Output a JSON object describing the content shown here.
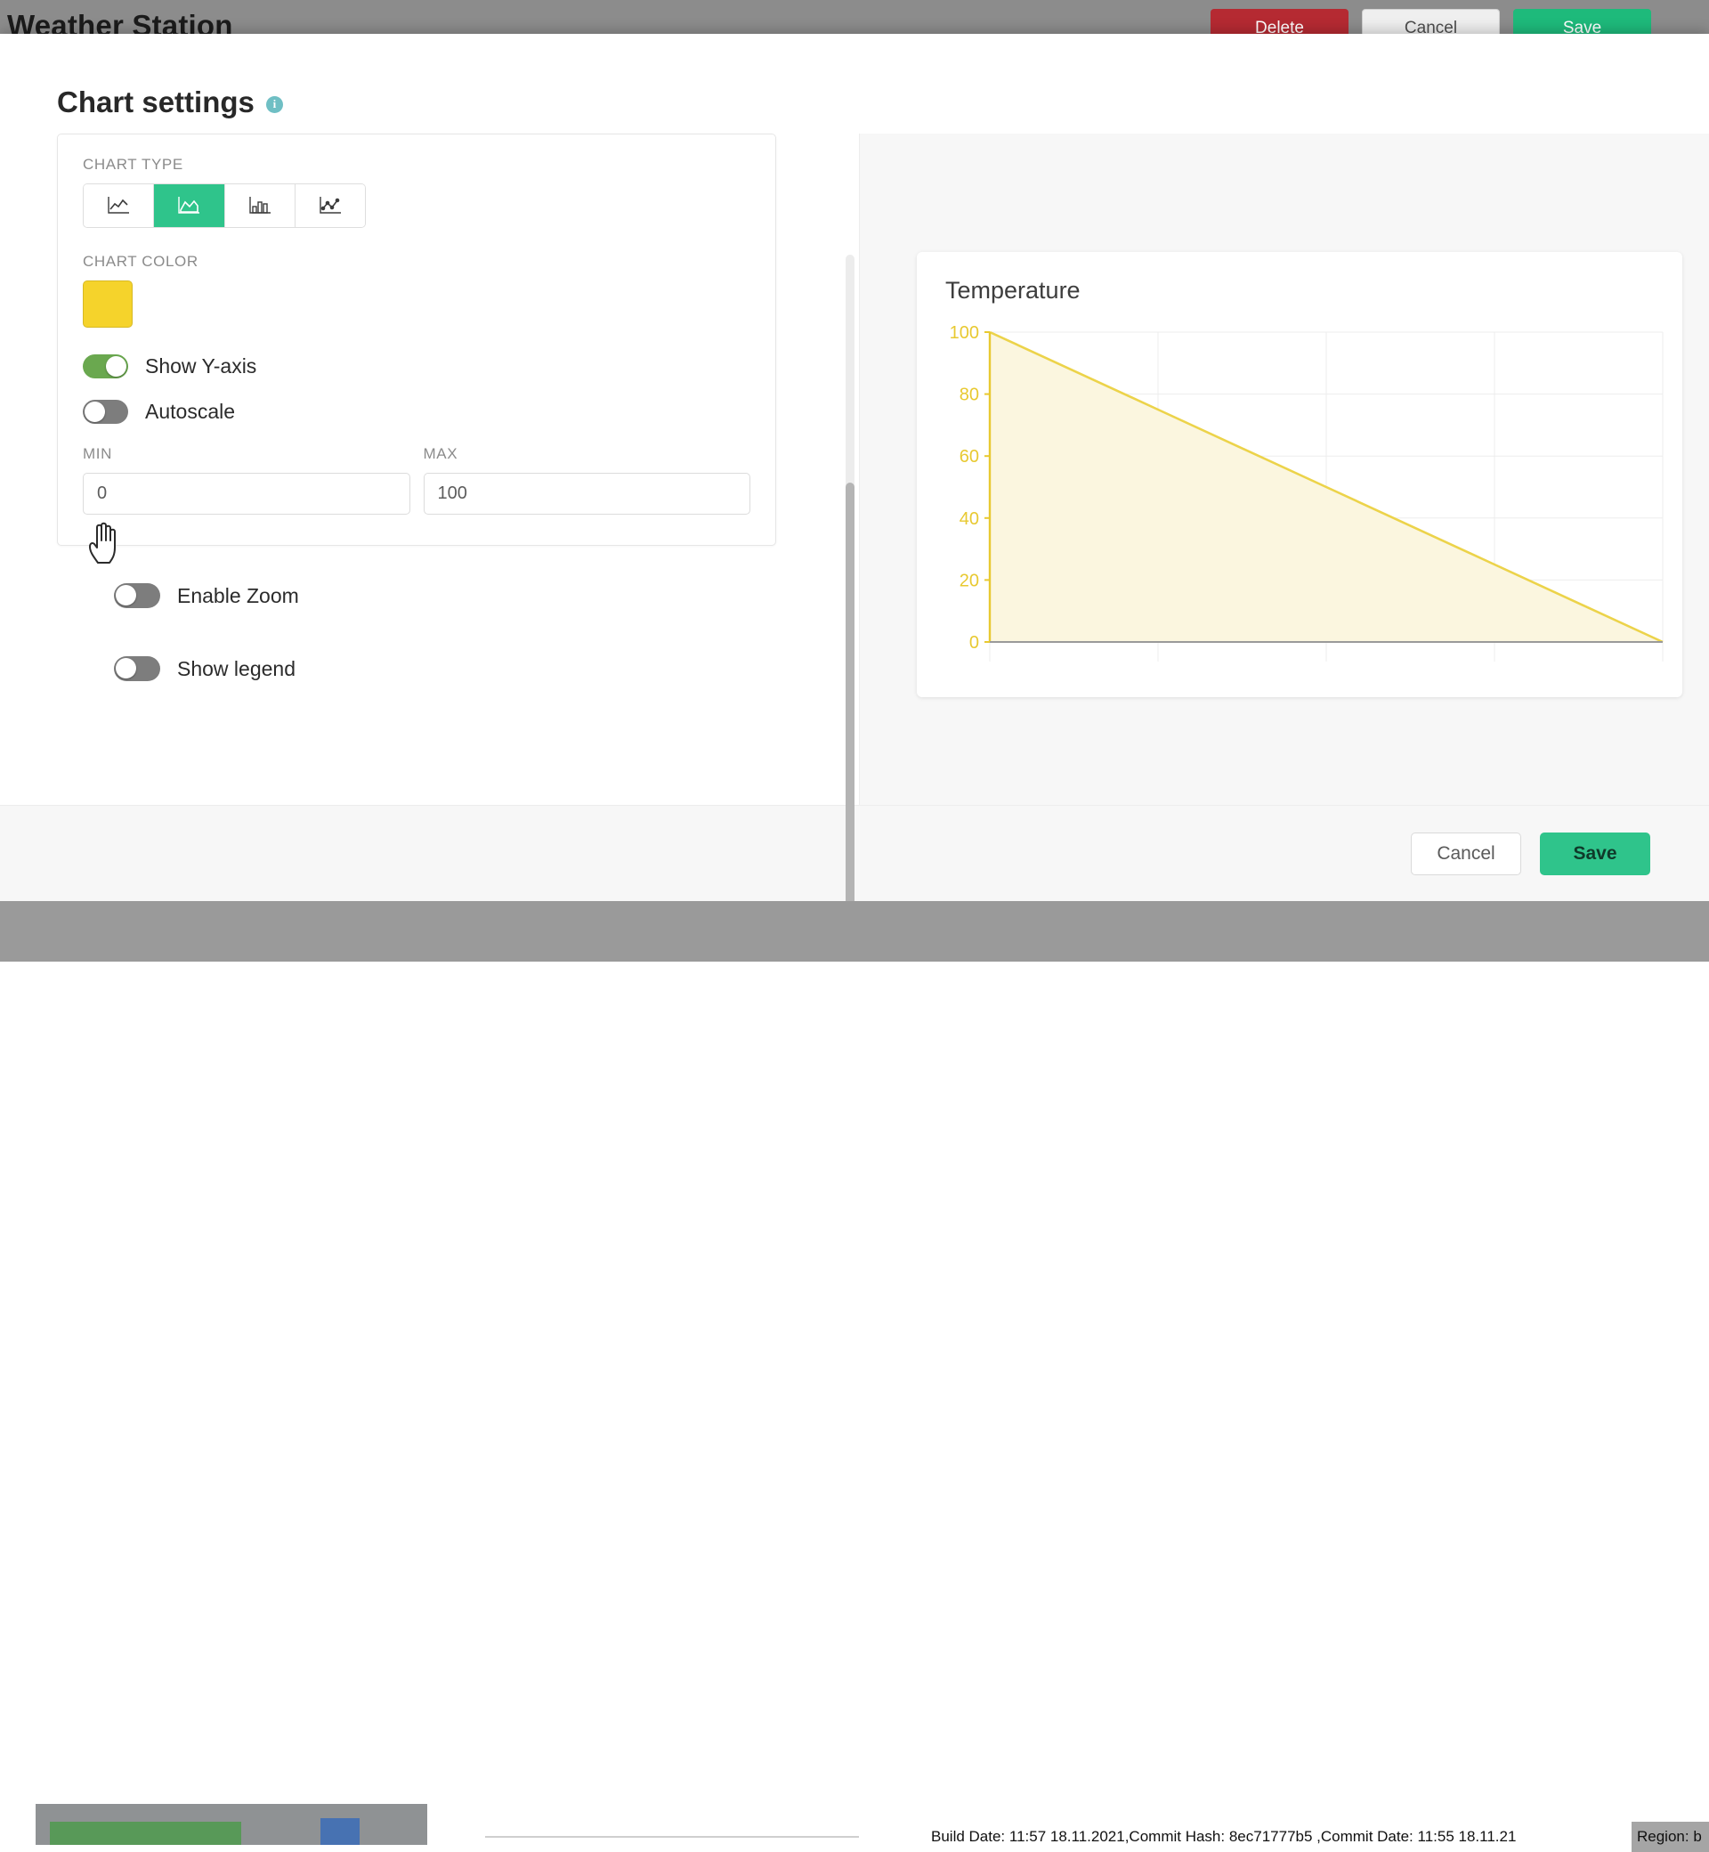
{
  "background_page": {
    "title": "Weather Station",
    "delete_label": "Delete",
    "cancel_label": "Cancel",
    "save_label": "Save",
    "build_info": "Build Date: 11:57 18.11.2021,Commit Hash: 8ec71777b5 ,Commit Date: 11:55 18.11.21",
    "region_label": "Region: b"
  },
  "dialog": {
    "title": "Chart settings",
    "info_icon": "info-icon",
    "chart_type": {
      "label": "CHART TYPE",
      "selected_index": 1,
      "options": [
        {
          "name": "line-chart-icon",
          "label": "Line"
        },
        {
          "name": "area-chart-icon",
          "label": "Area"
        },
        {
          "name": "bar-chart-icon",
          "label": "Bar"
        },
        {
          "name": "line-with-points-chart-icon",
          "label": "Line with points"
        }
      ]
    },
    "chart_color": {
      "label": "CHART COLOR",
      "value": "#F5D32B"
    },
    "toggles_card": [
      {
        "name": "show-y-axis-toggle",
        "label": "Show Y-axis",
        "on": true
      },
      {
        "name": "autoscale-toggle",
        "label": "Autoscale",
        "on": false
      }
    ],
    "min_field": {
      "label": "MIN",
      "value": "0",
      "placeholder": "0"
    },
    "max_field": {
      "label": "MAX",
      "value": "100",
      "placeholder": "100"
    },
    "toggles_outer": [
      {
        "name": "enable-zoom-toggle",
        "label": "Enable Zoom",
        "on": false
      },
      {
        "name": "show-legend-toggle",
        "label": "Show legend",
        "on": false
      }
    ],
    "footer": {
      "cancel_label": "Cancel",
      "save_label": "Save"
    },
    "accent_color": "#2FC48B"
  },
  "chart_data": {
    "type": "area",
    "title": "Temperature",
    "xlabel": "",
    "ylabel": "",
    "ylim": [
      0,
      100
    ],
    "yticks": [
      0,
      20,
      40,
      60,
      80,
      100
    ],
    "ytick_labels": [
      "0",
      "20",
      "40",
      "60",
      "80",
      "100"
    ],
    "grid": true,
    "legend": false,
    "line_color": "#ECD34A",
    "fill_color": "#FBF6DF",
    "axis_label_color": "#E8C931",
    "x": [
      0,
      1,
      2,
      3,
      4
    ],
    "series": [
      {
        "name": "Temperature",
        "values": [
          100,
          75,
          50,
          25,
          0
        ]
      }
    ]
  }
}
